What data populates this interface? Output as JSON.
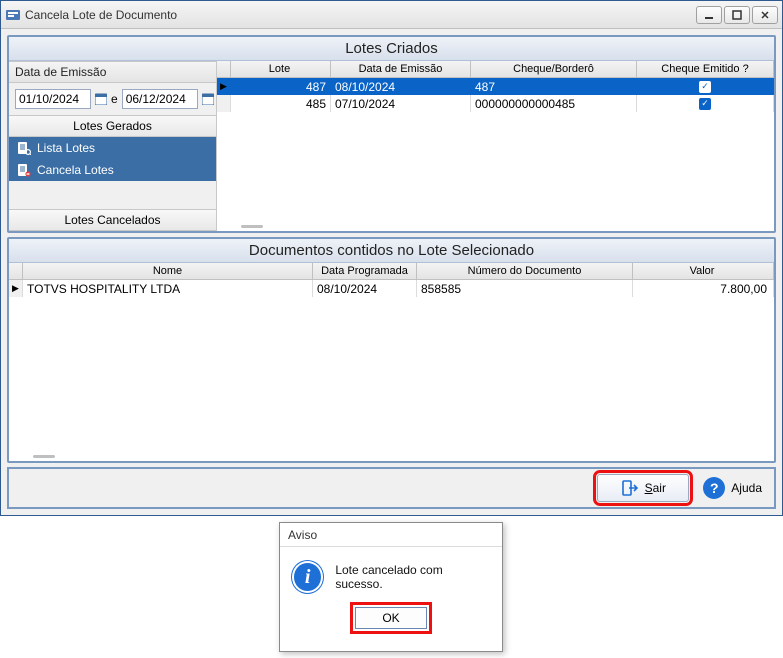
{
  "window": {
    "title": "Cancela Lote de Documento"
  },
  "upper": {
    "title": "Lotes Criados",
    "date_group": "Data de Emissão",
    "date_from": "01/10/2024",
    "date_sep": "e",
    "date_to": "06/12/2024",
    "section_generated": "Lotes Gerados",
    "action_list": "Lista Lotes",
    "action_cancel": "Cancela Lotes",
    "section_canceled": "Lotes Cancelados",
    "columns": {
      "lote": "Lote",
      "data": "Data de Emissão",
      "cheque": "Cheque/Borderô",
      "emitido": "Cheque Emitido ?"
    },
    "rows": [
      {
        "lote": "487",
        "data": "08/10/2024",
        "cheque": "487",
        "emitido": true,
        "selected": true
      },
      {
        "lote": "485",
        "data": "07/10/2024",
        "cheque": "000000000000485",
        "emitido": true,
        "selected": false
      }
    ]
  },
  "lower": {
    "title": "Documentos contidos no Lote Selecionado",
    "columns": {
      "nome": "Nome",
      "data": "Data Programada",
      "numero": "Número do Documento",
      "valor": "Valor"
    },
    "rows": [
      {
        "nome": "TOTVS HOSPITALITY LTDA",
        "data": "08/10/2024",
        "numero": "858585",
        "valor": "7.800,00"
      }
    ]
  },
  "footer": {
    "exit": "Sair",
    "help": "Ajuda"
  },
  "dialog": {
    "title": "Aviso",
    "message": "Lote cancelado com sucesso.",
    "ok": "OK"
  }
}
